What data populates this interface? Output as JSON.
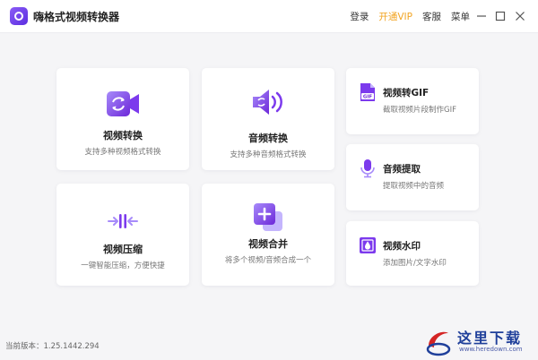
{
  "app": {
    "title": "嗨格式视频转换器"
  },
  "menu": {
    "login": "登录",
    "vip": "开通VIP",
    "service": "客服",
    "more": "菜单"
  },
  "theme": {
    "accent": "#7c4dff",
    "vip_color": "#f2a422"
  },
  "cards": {
    "video_convert": {
      "name": "视频转换",
      "desc": "支持多种视频格式转换",
      "icon": "video-convert-icon"
    },
    "audio_convert": {
      "name": "音频转换",
      "desc": "支持多种音频格式转换",
      "icon": "speaker-icon"
    },
    "video_gif": {
      "name": "视频转GIF",
      "desc": "截取视频片段制作GIF",
      "icon": "gif-file-icon",
      "badge": "GIF"
    },
    "video_compress": {
      "name": "视频压缩",
      "desc": "一键智能压缩，方便快捷",
      "icon": "compress-icon"
    },
    "video_merge": {
      "name": "视频合并",
      "desc": "将多个视频/音频合成一个",
      "icon": "merge-plus-icon"
    },
    "audio_extract": {
      "name": "音频提取",
      "desc": "提取视频中的音频",
      "icon": "microphone-icon"
    },
    "video_watermark": {
      "name": "视频水印",
      "desc": "添加图片/文字水印",
      "icon": "watermark-icon"
    }
  },
  "footer": {
    "version": "当前版本：1.25.1442.294"
  },
  "watermark": {
    "text": "这里下载",
    "url": "www.heredown.com"
  }
}
